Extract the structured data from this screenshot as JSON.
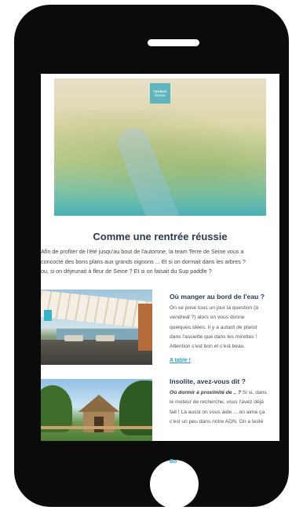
{
  "logo": {
    "line1": "TERRES",
    "line2": "Seine"
  },
  "headline": "Comme une rentrée réussie",
  "intro_lines": [
    "Afin de profiter de l'été jusqu'au bout de l'automne, la team Terre de Seine vous a",
    "concocté des bons plans aux grands oignons ... Et si on dormait dans les arbres ?",
    "ou, si on déjeunait à fleur de Seine ? Et si on faisait du Sup paddle ?"
  ],
  "article1": {
    "title": "Où manger au bord de l'eau ?",
    "lines": [
      "On se pose tous un jour la question (à",
      "vendredi ?) alors on vous donne",
      "quelques idées. Il y a autant de plaisir",
      "dans l'assiette que dans les mirettes !",
      "Attention c'est bon et c'est beau."
    ],
    "line2_italic": "vendredi",
    "line2_rest": " ?) alors on vous donne",
    "link": "A table !"
  },
  "article2": {
    "title": "Insolite, avez-vous dit ?",
    "line1_bold": "Où dormir à proximité de .. ?",
    "line1_rest": " Si si, dans",
    "lines": [
      "le moteur de recherche, vous l'avez déjà",
      "fait ! Là aussi on vous aide ... on aime ça",
      "c'est un peu dans notre ADN. On a testé"
    ]
  },
  "peek_link": "Bo"
}
